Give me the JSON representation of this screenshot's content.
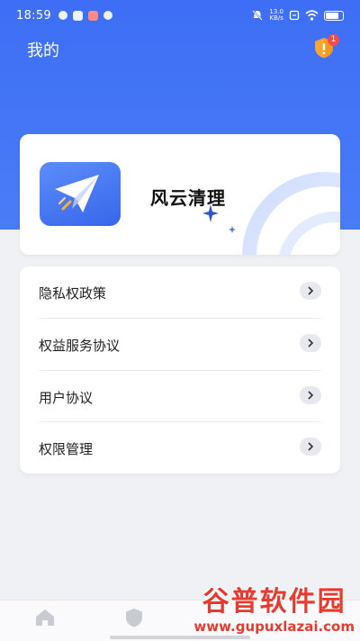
{
  "status_bar": {
    "time": "18:59",
    "speed_value": "13.0",
    "speed_unit": "KB/s"
  },
  "header": {
    "title": "我的",
    "notification_count": "1"
  },
  "app_card": {
    "app_name": "风云清理"
  },
  "menu": {
    "items": [
      {
        "label": "隐私权政策"
      },
      {
        "label": "权益服务协议"
      },
      {
        "label": "用户协议"
      },
      {
        "label": "权限管理"
      }
    ]
  },
  "watermark": {
    "brand": "谷普软件园",
    "url": "www.gupuxlazai.com"
  },
  "colors": {
    "header_blue": "#3d6ef5",
    "badge_red": "#f24b4b",
    "shield_orange": "#f7a635",
    "watermark_red": "#e83a2e"
  },
  "icons": [
    "home-icon",
    "shield-icon",
    "chevron-right-icon",
    "paper-plane-icon",
    "sparkle-icon"
  ]
}
